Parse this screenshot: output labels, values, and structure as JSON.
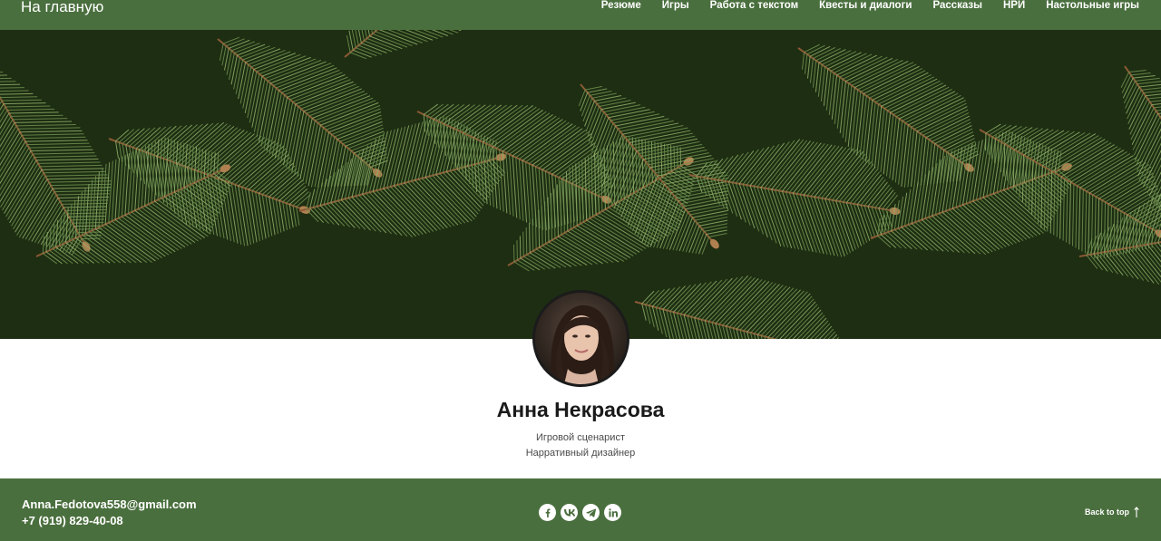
{
  "header": {
    "home_label": "На главную",
    "nav": [
      {
        "label": "Резюме"
      },
      {
        "label": "Игры"
      },
      {
        "label": "Работа с текстом"
      },
      {
        "label": "Квесты и диалоги"
      },
      {
        "label": "Рассказы"
      },
      {
        "label": "НРИ"
      },
      {
        "label": "Настольные игры"
      }
    ]
  },
  "profile": {
    "name": "Анна Некрасова",
    "roles": [
      "Игровой сценарист",
      "Нарративный дизайнер"
    ]
  },
  "footer": {
    "email": "Anna.Fedotova558@gmail.com",
    "phone": "+7 (919) 829-40-08",
    "socials": [
      {
        "icon": "facebook-icon"
      },
      {
        "icon": "vk-icon"
      },
      {
        "icon": "telegram-icon"
      },
      {
        "icon": "linkedin-icon"
      }
    ],
    "back_to_top": "Back to top",
    "back_to_top_icon": "arrow-up-icon"
  },
  "colors": {
    "bar_green": "#4a6f3e",
    "hero_dark": "#1e2e12",
    "needle_light": "#8fb06a",
    "twig_brown": "#8a5a35"
  }
}
